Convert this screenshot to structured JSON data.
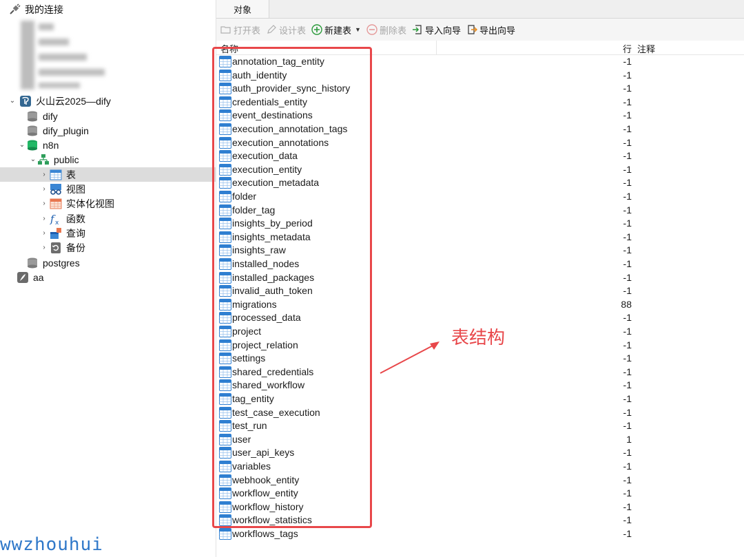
{
  "sidebar": {
    "root_label": "我的连接",
    "connection_label": "火山云2025—dify",
    "databases": [
      "dify",
      "dify_plugin",
      "n8n"
    ],
    "schema_label": "public",
    "schema_items": [
      "表",
      "视图",
      "实体化视图",
      "函数",
      "查询",
      "备份"
    ],
    "other_database": "postgres",
    "other_connection": "aa"
  },
  "tabs": [
    "对象"
  ],
  "toolbar": {
    "open_table": "打开表",
    "design_table": "设计表",
    "new_table": "新建表",
    "delete_table": "删除表",
    "import_wizard": "导入向导",
    "export_wizard": "导出向导"
  },
  "list_header": {
    "name": "名称",
    "rows": "行",
    "comment": "注释"
  },
  "tables": [
    {
      "name": "annotation_tag_entity",
      "rows": "-1"
    },
    {
      "name": "auth_identity",
      "rows": "-1"
    },
    {
      "name": "auth_provider_sync_history",
      "rows": "-1"
    },
    {
      "name": "credentials_entity",
      "rows": "-1"
    },
    {
      "name": "event_destinations",
      "rows": "-1"
    },
    {
      "name": "execution_annotation_tags",
      "rows": "-1"
    },
    {
      "name": "execution_annotations",
      "rows": "-1"
    },
    {
      "name": "execution_data",
      "rows": "-1"
    },
    {
      "name": "execution_entity",
      "rows": "-1"
    },
    {
      "name": "execution_metadata",
      "rows": "-1"
    },
    {
      "name": "folder",
      "rows": "-1"
    },
    {
      "name": "folder_tag",
      "rows": "-1"
    },
    {
      "name": "insights_by_period",
      "rows": "-1"
    },
    {
      "name": "insights_metadata",
      "rows": "-1"
    },
    {
      "name": "insights_raw",
      "rows": "-1"
    },
    {
      "name": "installed_nodes",
      "rows": "-1"
    },
    {
      "name": "installed_packages",
      "rows": "-1"
    },
    {
      "name": "invalid_auth_token",
      "rows": "-1"
    },
    {
      "name": "migrations",
      "rows": "88"
    },
    {
      "name": "processed_data",
      "rows": "-1"
    },
    {
      "name": "project",
      "rows": "-1"
    },
    {
      "name": "project_relation",
      "rows": "-1"
    },
    {
      "name": "settings",
      "rows": "-1"
    },
    {
      "name": "shared_credentials",
      "rows": "-1"
    },
    {
      "name": "shared_workflow",
      "rows": "-1"
    },
    {
      "name": "tag_entity",
      "rows": "-1"
    },
    {
      "name": "test_case_execution",
      "rows": "-1"
    },
    {
      "name": "test_run",
      "rows": "-1"
    },
    {
      "name": "user",
      "rows": "1"
    },
    {
      "name": "user_api_keys",
      "rows": "-1"
    },
    {
      "name": "variables",
      "rows": "-1"
    },
    {
      "name": "webhook_entity",
      "rows": "-1"
    },
    {
      "name": "workflow_entity",
      "rows": "-1"
    },
    {
      "name": "workflow_history",
      "rows": "-1"
    },
    {
      "name": "workflow_statistics",
      "rows": "-1"
    },
    {
      "name": "workflows_tags",
      "rows": "-1"
    }
  ],
  "annotation": {
    "label": "表结构",
    "color": "#e8474a"
  },
  "watermark": "wwzhouhui"
}
